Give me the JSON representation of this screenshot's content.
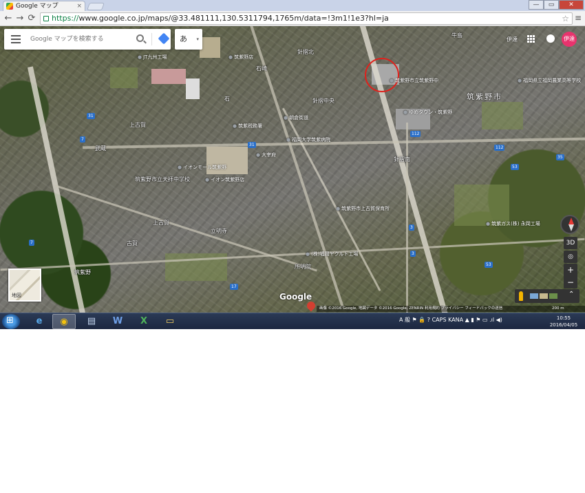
{
  "browser": {
    "tab_title": "Google マップ",
    "tab_close": "×",
    "url_scheme": "https://",
    "url_rest": "www.google.co.jp/maps/@33.481111,130.5311794,1765m/data=!3m1!1e3?hl=ja",
    "back": "←",
    "forward": "→",
    "reload": "⟳",
    "star": "☆",
    "menu": "≡",
    "win_min": "—",
    "win_max": "▭",
    "win_close": "✕"
  },
  "search": {
    "placeholder": "Google マップを検索する",
    "ime_label": "あ",
    "ime_arrow": "▾"
  },
  "topright": {
    "user_label": "伊達",
    "avatar_text": "伊達"
  },
  "map": {
    "labels": [
      {
        "text": "牛島",
        "kind": "normal"
      },
      {
        "text": "針摺北",
        "kind": "normal"
      },
      {
        "text": "石崎",
        "kind": "normal"
      },
      {
        "text": "石",
        "kind": "normal"
      },
      {
        "text": "筑紫野市",
        "kind": "big"
      },
      {
        "text": "針摺中央",
        "kind": "normal"
      },
      {
        "text": "上古賀",
        "kind": "normal"
      },
      {
        "text": "武蔵",
        "kind": "normal"
      },
      {
        "text": "筑紫野市立天拝中学校",
        "kind": "normal"
      },
      {
        "text": "上古賀",
        "kind": "normal"
      },
      {
        "text": "立明寺",
        "kind": "normal"
      },
      {
        "text": "古賀",
        "kind": "normal"
      },
      {
        "text": "所明院",
        "kind": "normal"
      },
      {
        "text": "針摺南",
        "kind": "normal"
      },
      {
        "text": "筑紫野",
        "kind": "normal"
      }
    ],
    "pois": [
      {
        "text": "JT九州工場"
      },
      {
        "text": "筑紫野店"
      },
      {
        "text": "筑紫野市立筑紫野中"
      },
      {
        "text": "ゆめタウン・筑紫野"
      },
      {
        "text": "福岡県立福岡農業高等学校"
      },
      {
        "text": "朝倉街道"
      },
      {
        "text": "筑紫税務署"
      },
      {
        "text": "福岡大学筑紫病院"
      },
      {
        "text": "イオンモール筑紫野"
      },
      {
        "text": "イオン筑紫野店"
      },
      {
        "text": "筑紫野市上古賀保育所"
      },
      {
        "text": "(株)福岡ヤクルト工場"
      },
      {
        "text": "筑紫ガス(株) 永岡工場"
      },
      {
        "text": "大宰府"
      }
    ],
    "route_shields": [
      "31",
      "31",
      "112",
      "112",
      "53",
      "35",
      "3",
      "3",
      "53",
      "17",
      "7",
      "7"
    ],
    "minimap_label": "地図",
    "google_logo": "Google",
    "layers_expand": "⌃",
    "attribution": "画像 ©2016 Google, 地図データ ©2016 Google, ZENRIN   利用規約   プライバシー   フィードバックの送信",
    "scale": "200 m",
    "controls": {
      "three_d": "3D",
      "locate": "◎",
      "zoom_in": "+",
      "zoom_out": "−"
    }
  },
  "taskbar": {
    "apps": [
      {
        "name": "ie",
        "glyph": "e"
      },
      {
        "name": "chrome",
        "glyph": "◉"
      },
      {
        "name": "explorer-files",
        "glyph": "▤"
      },
      {
        "name": "word",
        "glyph": "W"
      },
      {
        "name": "excel",
        "glyph": "X"
      },
      {
        "name": "folder",
        "glyph": "▭"
      }
    ],
    "tray_text": "A 般 ⚑ 🔒 ? CAPS KANA ▲ ▮ ⚑ ▭ .ıl ◀)",
    "time": "10:55",
    "date": "2016/04/05"
  }
}
